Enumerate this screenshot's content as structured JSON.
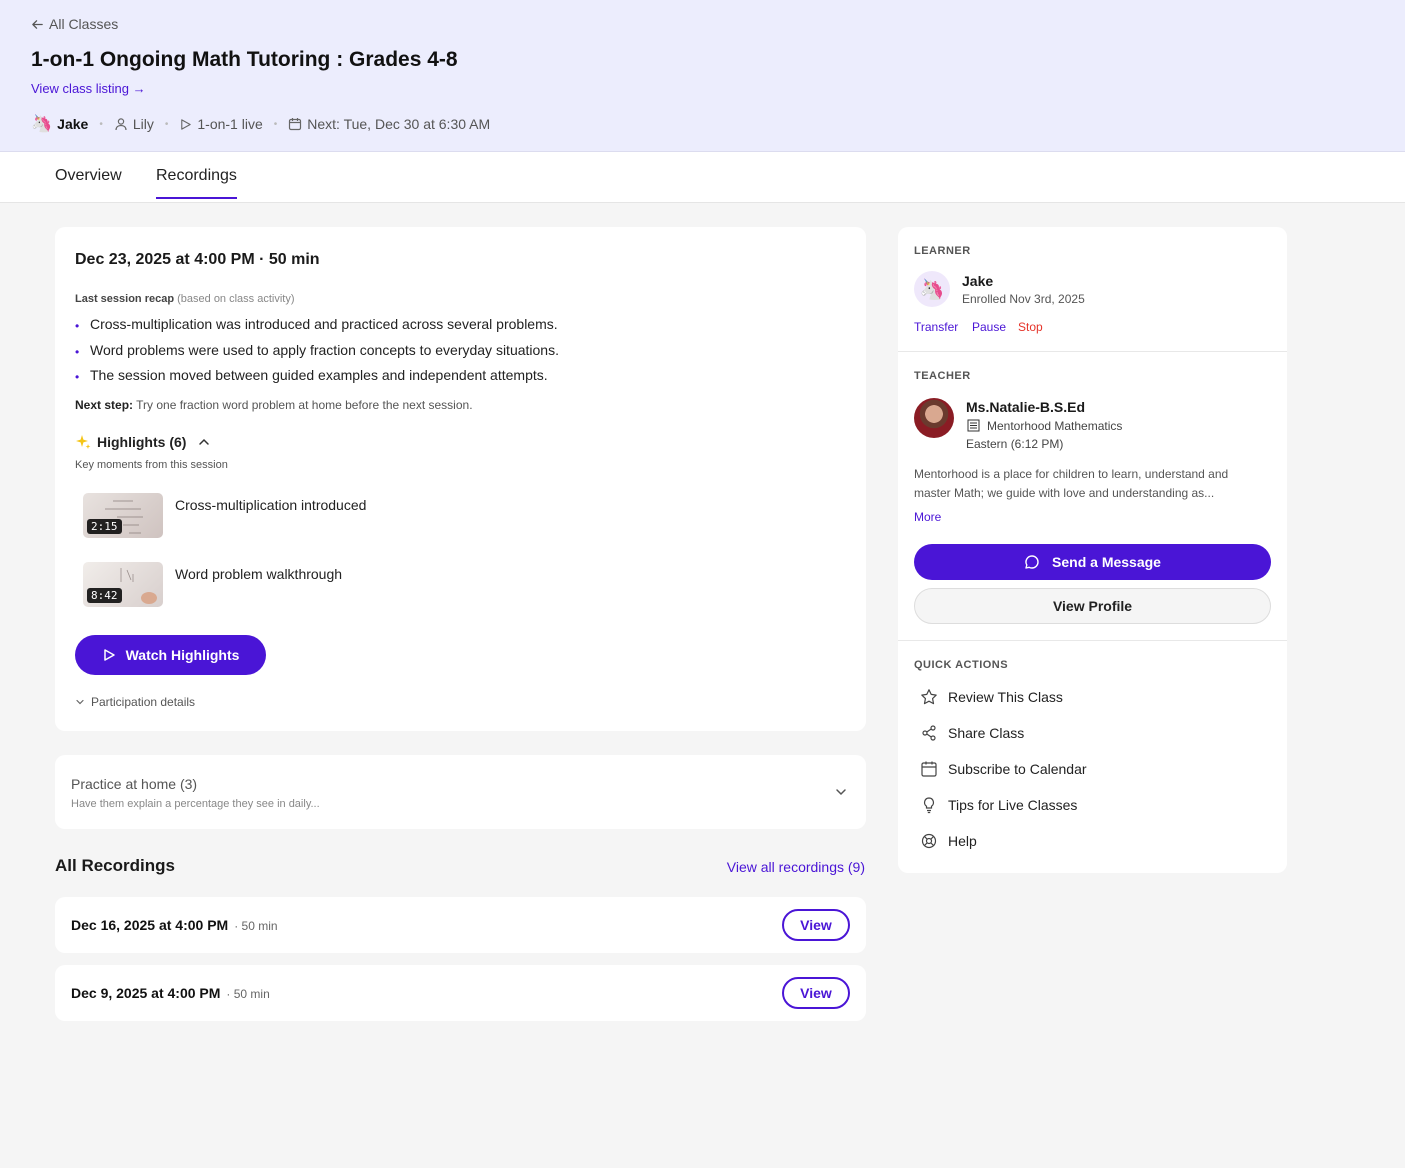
{
  "header": {
    "back_label": "All Classes",
    "title": "1-on-1 Ongoing Math Tutoring : Grades 4-8",
    "listing_link": "View class listing →",
    "learner": "Jake",
    "teacher": "Lily",
    "format": "1-on-1 live",
    "next": "Next: Tue, Dec 30 at 6:30 AM"
  },
  "tabs": [
    {
      "label": "Overview",
      "active": false
    },
    {
      "label": "Recordings",
      "active": true
    }
  ],
  "session": {
    "title": "Dec 23, 2025 at 4:00 PM · 50 min",
    "recap_label": "Last session recap",
    "recap_note": "(based on class activity)",
    "bullets": [
      "Cross-multiplication was introduced and practiced across several problems.",
      "Word problems were used to apply fraction concepts to everyday situations.",
      "The session moved between guided examples and independent attempts."
    ],
    "next_step_label": "Next step:",
    "next_step": "Try one fraction word problem at home before the next session.",
    "highlights_label": "Highlights (6)",
    "highlights_sub": "Key moments from this session",
    "clips": [
      {
        "time": "2:15",
        "label": "Cross-multiplication introduced"
      },
      {
        "time": "8:42",
        "label": "Word problem walkthrough"
      }
    ],
    "watch_button": "Watch Highlights",
    "participation": "Participation details"
  },
  "practice": {
    "title": "Practice at home (3)",
    "subtitle": "Have them explain a percentage they see in daily..."
  },
  "recordings": {
    "heading": "All Recordings",
    "view_all": "View all recordings (9)",
    "items": [
      {
        "date": "Dec 16, 2025 at 4:00 PM",
        "duration": "· 50 min",
        "button": "View"
      },
      {
        "date": "Dec 9, 2025 at 4:00 PM",
        "duration": "· 50 min",
        "button": "View"
      }
    ]
  },
  "sidebar": {
    "learner_label": "LEARNER",
    "learner_name": "Jake",
    "learner_enrolled": "Enrolled Nov 3rd, 2025",
    "actions": [
      {
        "label": "Transfer",
        "color": "#4a15d6"
      },
      {
        "label": "Pause",
        "color": "#4a15d6"
      },
      {
        "label": "Stop",
        "color": "#e5342a"
      }
    ],
    "teacher_label": "TEACHER",
    "teacher_name": "Ms.Natalie-B.S.Ed",
    "teacher_org": "Mentorhood Mathematics",
    "teacher_tz": "Eastern (6:12 PM)",
    "teacher_bio": "Mentorhood is a place for children to learn, understand and master Math; we guide with love and understanding as...",
    "more": "More",
    "message_button": "Send a Message",
    "profile_button": "View Profile",
    "quick_label": "QUICK ACTIONS",
    "quick_actions": [
      {
        "label": "Review This Class",
        "icon": "star-icon"
      },
      {
        "label": "Share Class",
        "icon": "share-icon"
      },
      {
        "label": "Subscribe to Calendar",
        "icon": "calendar-icon"
      },
      {
        "label": "Tips for Live Classes",
        "icon": "lightbulb-icon"
      },
      {
        "label": "Help",
        "icon": "help-icon"
      }
    ]
  },
  "colors": {
    "accent": "#4a15d6",
    "danger": "#e5342a",
    "header_bg": "#ecedfd"
  }
}
